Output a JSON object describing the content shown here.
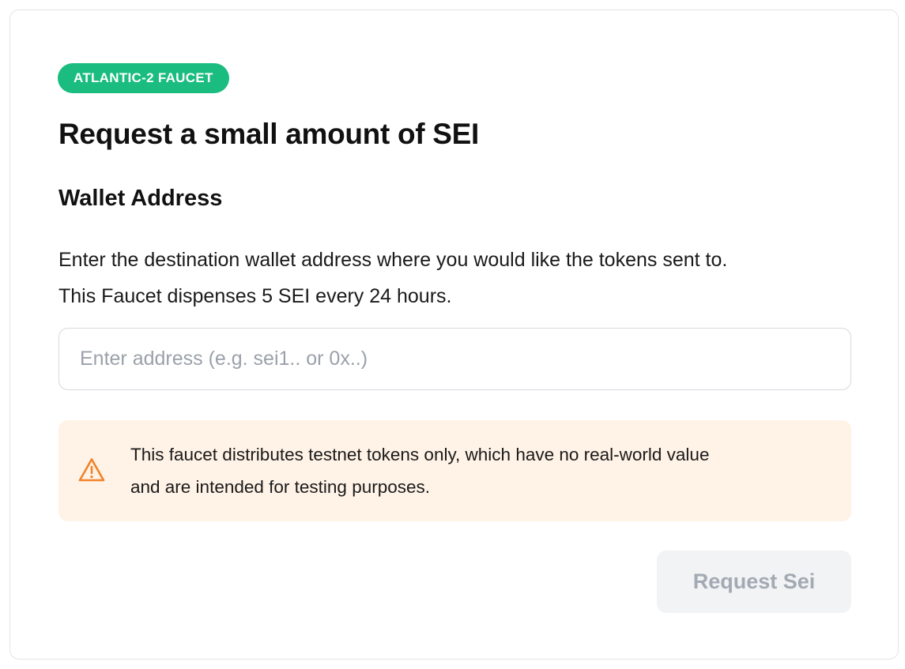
{
  "badge": {
    "label": "ATLANTIC-2 FAUCET",
    "color": "#1abc7f"
  },
  "heading": {
    "title": "Request a small amount of SEI"
  },
  "wallet": {
    "label": "Wallet Address",
    "description_lines": [
      "Enter the destination wallet address where you would like the tokens sent to.",
      "This Faucet dispenses 5 SEI every 24 hours."
    ],
    "input": {
      "value": "",
      "placeholder": "Enter address (e.g. sei1.. or 0x..)"
    }
  },
  "warning": {
    "icon": "warning-triangle-icon",
    "text_lines": [
      "This faucet distributes testnet tokens only, which have no real-world value",
      "and are intended for testing purposes."
    ],
    "background": "#fff2e6",
    "icon_color": "#f0832a"
  },
  "actions": {
    "request_label": "Request Sei",
    "disabled": true,
    "button_background": "#f1f3f5",
    "button_text_color": "#a3aab3"
  }
}
